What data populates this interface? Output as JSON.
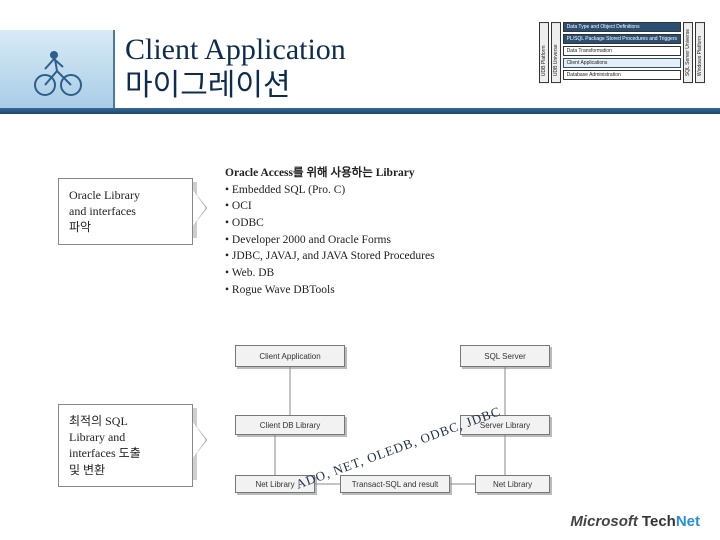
{
  "title_line1": "Client Application",
  "title_line2": "마이그레이션",
  "rightTabs": {
    "leftVert": "UDB Platform",
    "midVert": "UDB Universe",
    "centerItems": [
      "Data Type and Object Definitions",
      "PL/SQL Package Stored Procedures and Triggers",
      "Data Transformation",
      "Client Applications",
      "Database Administration"
    ],
    "rightVert1": "SQL Server Universe",
    "rightVert2": "Windows Platform"
  },
  "step1": "Oracle Library\nand interfaces\n파악",
  "step2": "최적의 SQL\nLibrary and\ninterfaces 도출\n및 변환",
  "lib": {
    "head": "Oracle Access를 위해 사용하는 Library",
    "items": [
      "Embedded SQL (Pro. C)",
      "OCI",
      "ODBC",
      "Developer 2000 and Oracle Forms",
      "JDBC, JAVAJ, and JAVA Stored Procedures",
      "Web. DB",
      "Rogue Wave DBTools"
    ]
  },
  "diagram": {
    "top1": "Client Application",
    "top2": "SQL Server",
    "mid1": "Client DB Library",
    "mid2": "Server Library",
    "bot1": "Net Library",
    "bot2": "Transact-SQL and result",
    "bot3": "Net Library"
  },
  "angled": "ADO, NET, OLEDB, ODBC, JDBC",
  "logo": {
    "ms": "Microsoft",
    "tech": "Tech",
    "net": "Net"
  }
}
